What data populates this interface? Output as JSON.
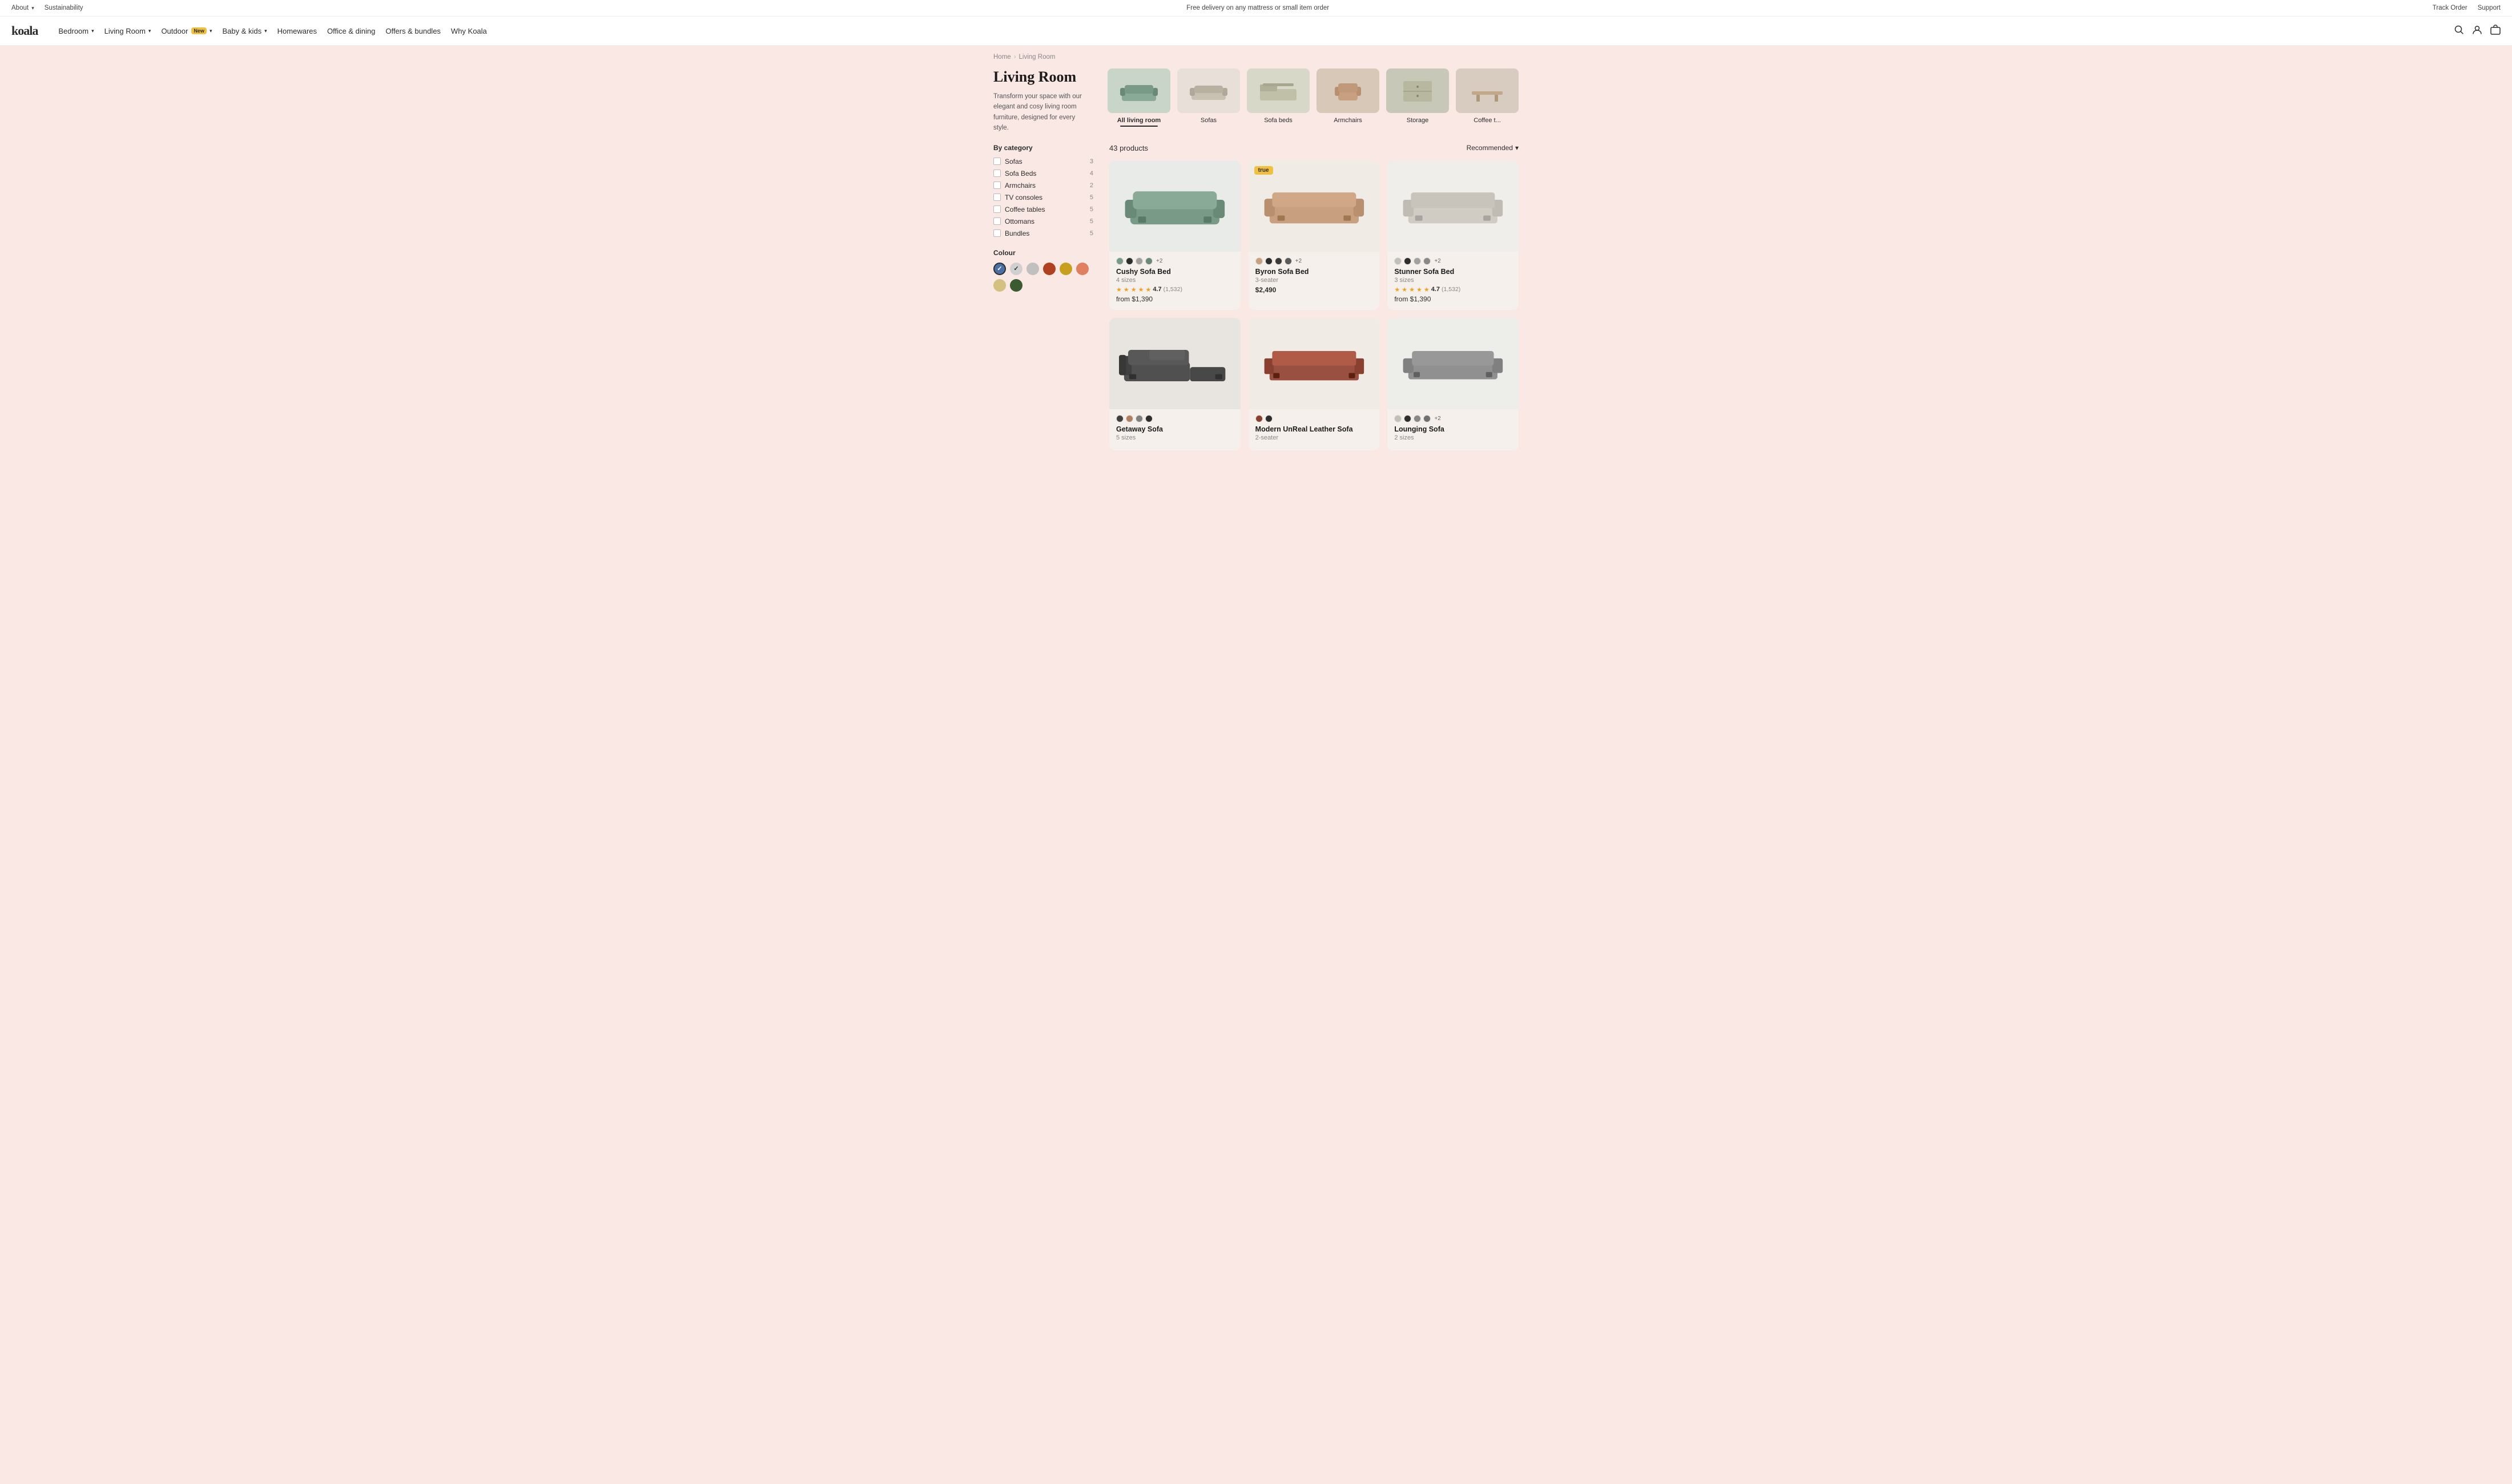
{
  "topbar": {
    "left": [
      {
        "label": "About",
        "hasDropdown": true
      },
      {
        "label": "Sustainability",
        "hasDropdown": false
      }
    ],
    "center": "Free delivery on any mattress or small item order",
    "right": [
      {
        "label": "Track Order"
      },
      {
        "label": "Support"
      }
    ]
  },
  "nav": {
    "logo": "koala",
    "links": [
      {
        "label": "Bedroom",
        "hasDropdown": true,
        "hasBadge": false
      },
      {
        "label": "Living Room",
        "hasDropdown": true,
        "hasBadge": false
      },
      {
        "label": "Outdoor",
        "hasDropdown": true,
        "hasBadge": true,
        "badge": "New"
      },
      {
        "label": "Baby & kids",
        "hasDropdown": true,
        "hasBadge": false
      },
      {
        "label": "Homewares",
        "hasDropdown": false,
        "hasBadge": false
      },
      {
        "label": "Office & dining",
        "hasDropdown": false,
        "hasBadge": false
      },
      {
        "label": "Offers & bundles",
        "hasDropdown": false,
        "hasBadge": false
      },
      {
        "label": "Why Koala",
        "hasDropdown": false,
        "hasBadge": false
      }
    ],
    "cart_count": "0"
  },
  "breadcrumb": {
    "home": "Home",
    "current": "Living Room"
  },
  "hero": {
    "title": "Living Room",
    "description": "Transform your space with our elegant and cosy living room furniture, designed for every style."
  },
  "categories": [
    {
      "label": "All living room",
      "active": true,
      "colorClass": "cat-allroom",
      "emoji": "🛋️"
    },
    {
      "label": "Sofas",
      "active": false,
      "colorClass": "cat-sofas",
      "emoji": "🛋️"
    },
    {
      "label": "Sofa beds",
      "active": false,
      "colorClass": "cat-sofabeds",
      "emoji": "🛏️"
    },
    {
      "label": "Armchairs",
      "active": false,
      "colorClass": "cat-armchairs",
      "emoji": "🪑"
    },
    {
      "label": "Storage",
      "active": false,
      "colorClass": "cat-storage",
      "emoji": "🗄️"
    },
    {
      "label": "Coffee t...",
      "active": false,
      "colorClass": "cat-coffee",
      "emoji": "☕"
    }
  ],
  "filters": {
    "title": "By category",
    "items": [
      {
        "label": "Sofas",
        "count": 3
      },
      {
        "label": "Sofa Beds",
        "count": 4
      },
      {
        "label": "Armchairs",
        "count": 2
      },
      {
        "label": "TV consoles",
        "count": 5
      },
      {
        "label": "Coffee tables",
        "count": 5
      },
      {
        "label": "Ottomans",
        "count": 5
      },
      {
        "label": "Bundles",
        "count": 5
      }
    ],
    "colour_title": "Colour",
    "colours": [
      {
        "hex": "#4a6fa5",
        "active": true,
        "hasCheck": true,
        "checkDark": false
      },
      {
        "hex": "#d0d0d0",
        "active": false,
        "hasCheck": true,
        "checkDark": true
      },
      {
        "hex": "#c8c8c8",
        "active": false,
        "hasCheck": false,
        "checkDark": false
      },
      {
        "hex": "#b04020",
        "active": false,
        "hasCheck": false,
        "checkDark": false
      },
      {
        "hex": "#c8a020",
        "active": false,
        "hasCheck": false,
        "checkDark": false
      },
      {
        "hex": "#e08060",
        "active": false,
        "hasCheck": false,
        "checkDark": false
      },
      {
        "hex": "#d4c080",
        "active": false,
        "hasCheck": false,
        "checkDark": false
      },
      {
        "hex": "#3a5a30",
        "active": false,
        "hasCheck": false,
        "checkDark": false
      }
    ]
  },
  "products": {
    "count": "43 products",
    "sort_label": "Recommended",
    "items": [
      {
        "name": "Cushy Sofa Bed",
        "size": "4 sizes",
        "rating": "4.7",
        "reviews": "1,532",
        "price": "from $1,390",
        "price_type": "from",
        "isNew": false,
        "colors": [
          "#7a9a88",
          "#2d2d2d",
          "#a0a0a0",
          "#6a8a78"
        ],
        "extra_colors": "+2",
        "bg": "#e8ebe8"
      },
      {
        "name": "Byron Sofa Bed",
        "size": "3-seater",
        "rating": "",
        "reviews": "",
        "price": "$2,490",
        "price_type": "fixed",
        "isNew": true,
        "colors": [
          "#c8a080",
          "#2d2d2d",
          "#3a3a3a",
          "#5a5a5a"
        ],
        "extra_colors": "+2",
        "bg": "#f0ebe4"
      },
      {
        "name": "Stunner Sofa Bed",
        "size": "3 sizes",
        "rating": "4.7",
        "reviews": "1,532",
        "price": "from $1,390",
        "price_type": "from",
        "isNew": false,
        "colors": [
          "#c0c0b8",
          "#2d2d2d",
          "#a0a0a0",
          "#888888"
        ],
        "extra_colors": "+2",
        "bg": "#f0eeea"
      },
      {
        "name": "Getaway Sofa",
        "size": "5 sizes",
        "rating": "",
        "reviews": "",
        "price": "",
        "price_type": "",
        "isNew": false,
        "colors": [
          "#404040",
          "#b08060",
          "#808080",
          "#2d2d2d"
        ],
        "extra_colors": "",
        "bg": "#e8e5e0"
      },
      {
        "name": "Modern UnReal Leather Sofa",
        "size": "2-seater",
        "rating": "",
        "reviews": "",
        "price": "",
        "price_type": "",
        "isNew": false,
        "colors": [
          "#8a4030",
          "#2d2d2d"
        ],
        "extra_colors": "",
        "bg": "#f0ebe4"
      },
      {
        "name": "Lounging Sofa",
        "size": "2 sizes",
        "rating": "",
        "reviews": "",
        "price": "",
        "price_type": "",
        "isNew": false,
        "colors": [
          "#c0c0b8",
          "#2d2d2d",
          "#888888",
          "#707070"
        ],
        "extra_colors": "+2",
        "bg": "#ededea"
      }
    ]
  }
}
